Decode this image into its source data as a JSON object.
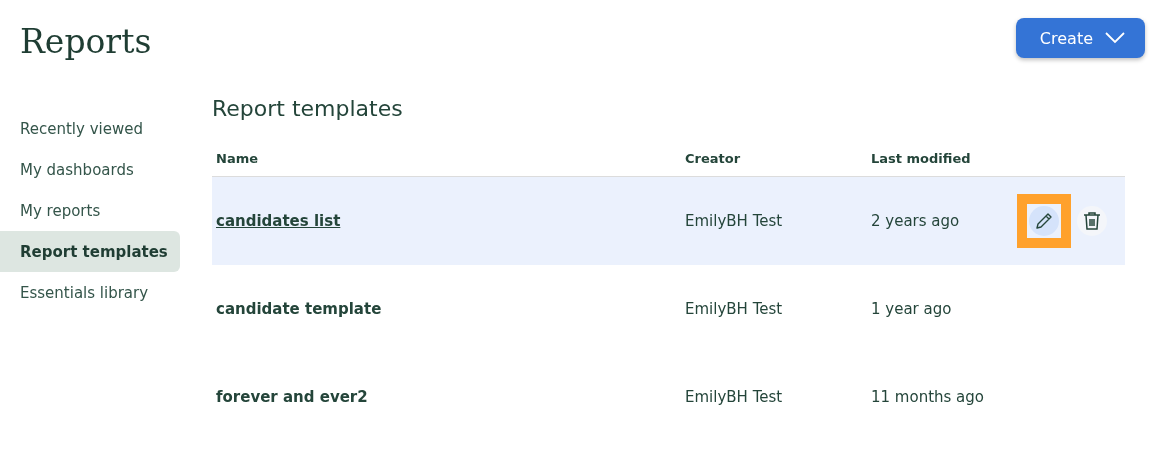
{
  "page": {
    "title": "Reports"
  },
  "create_button": {
    "label": "Create"
  },
  "sidebar": {
    "items": [
      {
        "label": "Recently viewed",
        "selected": false
      },
      {
        "label": "My dashboards",
        "selected": false
      },
      {
        "label": "My reports",
        "selected": false
      },
      {
        "label": "Report templates",
        "selected": true
      },
      {
        "label": "Essentials library",
        "selected": false
      }
    ]
  },
  "section": {
    "title": "Report templates"
  },
  "table": {
    "columns": [
      "Name",
      "Creator",
      "Last modified"
    ],
    "rows": [
      {
        "name": "candidates list",
        "creator": "EmilyBH Test",
        "modified": "2 years ago",
        "hovered": true,
        "actions": {
          "edit_highlighted": true
        }
      },
      {
        "name": "candidate template",
        "creator": "EmilyBH Test",
        "modified": "1 year ago",
        "hovered": false
      },
      {
        "name": "forever and ever2",
        "creator": "EmilyBH Test",
        "modified": "11 months ago",
        "hovered": false
      }
    ]
  }
}
